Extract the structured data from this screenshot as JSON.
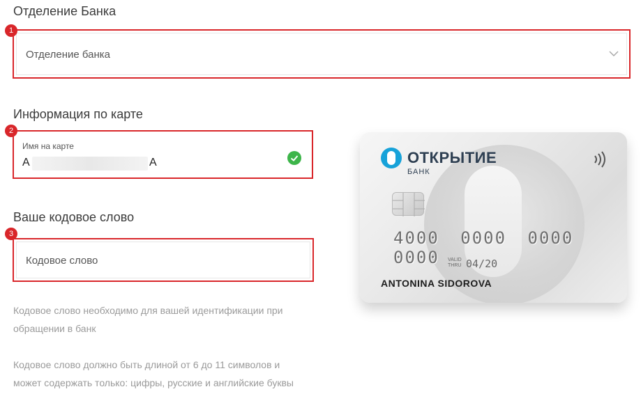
{
  "sections": {
    "branch_title": "Отделение Банка",
    "card_info_title": "Информация по карте",
    "codeword_title": "Ваше кодовое слово"
  },
  "markers": [
    "1",
    "2",
    "3"
  ],
  "fields": {
    "branch": {
      "placeholder": "Отделение банка",
      "icon": "chevron-down-icon"
    },
    "card_name": {
      "label": "Имя на карте",
      "value_start": "А",
      "value_end": "А",
      "status_icon": "check-circle-icon",
      "status_color": "#3db54a"
    },
    "codeword": {
      "placeholder": "Кодовое слово"
    }
  },
  "hints": {
    "line1": "Кодовое слово необходимо для вашей идентификации при обращении в банк",
    "line2": "Кодовое слово должно быть длиной от 6 до 11 символов и может содержать только: цифры, русские и английские буквы"
  },
  "card": {
    "brand": "ОТКРЫТИЕ",
    "brand_sub": "БАНК",
    "number": "4000 0000 0000 0000",
    "valid_label": "VALID\nTHRU",
    "valid_date": "04/20",
    "holder": "ANTONINA SIDOROVA",
    "brand_color": "#17a2d9"
  },
  "colors": {
    "highlight": "#d9262a"
  }
}
